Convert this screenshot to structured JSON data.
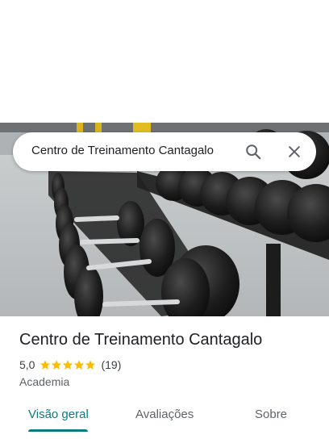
{
  "search": {
    "value": "Centro de Treinamento Cantagalo"
  },
  "place": {
    "name": "Centro de Treinamento Cantagalo",
    "rating": "5,0",
    "stars": 5,
    "reviews_count": "(19)",
    "category": "Academia"
  },
  "tabs": [
    {
      "label": "Visão geral",
      "selected": true
    },
    {
      "label": "Avaliações",
      "selected": false
    },
    {
      "label": "Sobre",
      "selected": false
    }
  ],
  "icons": {
    "search": "search-icon",
    "close": "close-icon",
    "star": "star-icon"
  },
  "colors": {
    "accent": "#0b7a7e",
    "star": "#fbbc04",
    "text": "#202124",
    "muted": "#5f6368"
  }
}
